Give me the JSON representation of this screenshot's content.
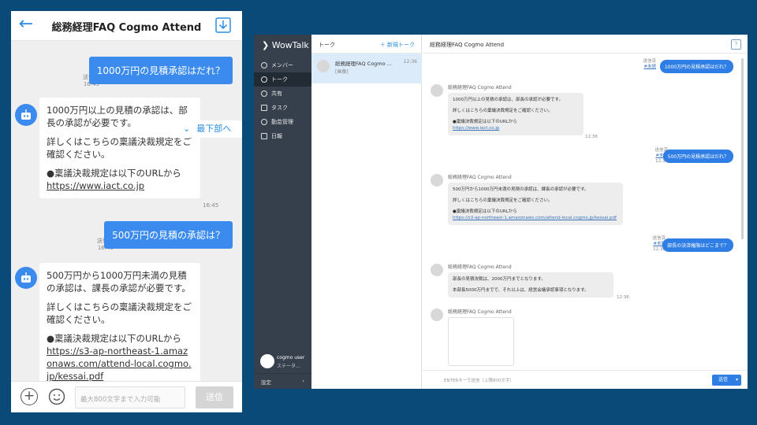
{
  "mobile": {
    "title": "総務経理FAQ Cogmo Attend",
    "messages": [
      {
        "text": "1000万円の見積承認はだれ？",
        "status": "送信済",
        "time": "16:45"
      },
      {
        "text": "500万円の見積の承認は？",
        "status": "送信済",
        "time": "16:45"
      }
    ],
    "reply1": {
      "p1": "1000万円以上の見積の承認は、部長の承認が必要です。",
      "p2": "詳しくはこちらの稟議決裁規定をご確認ください。",
      "p3": "●稟議決裁規定は以下のURLから",
      "url": "https://www.iact.co.jp",
      "time": "16:45"
    },
    "reply2": {
      "p1": "500万円から1000万円未満の見積の承認は、課長の承認が必要です。",
      "p2": "詳しくはこちらの稟議決裁規定をご確認ください。",
      "p3": "●稟議決裁規定は以下のURLから",
      "url": "https://s3-ap-northeast-1.amazonaws.com/attend-local.cogmo.jp/kessai.pdf"
    },
    "scroll_bottom": "最下部へ",
    "input_placeholder": "最大800文字まで入力可能",
    "send": "送信"
  },
  "desktop": {
    "app_name": "WowTalk",
    "sidebar": [
      {
        "label": "メンバー",
        "icon": "person-icon"
      },
      {
        "label": "トーク",
        "icon": "chat-icon"
      },
      {
        "label": "共有",
        "icon": "share-icon"
      },
      {
        "label": "タスク",
        "icon": "task-icon"
      },
      {
        "label": "勤怠管理",
        "icon": "clock-icon"
      },
      {
        "label": "日報",
        "icon": "report-icon"
      }
    ],
    "user_name": "cogmo user",
    "user_status": "ステータ...",
    "settings": "設定",
    "talk_header": "トーク",
    "new_talk": "＋ 新規トーク",
    "talk_item": {
      "name": "総務経理FAQ Cogmo ...",
      "sub": "[画像]",
      "time": "12:36"
    },
    "chat_title": "総務経理FAQ Cogmo Attend",
    "out_status": "送信済",
    "out_read": "#未読",
    "bot_name": "総務経理FAQ Cogmo Attend",
    "out1": "1000万円の見積承認はだれ？",
    "in1_l1": "1000万円以上の見積の承認は、部長の承認が必要です。",
    "in1_l2": "詳しくはこちらの稟議決裁規定をご確認ください。",
    "in1_l3": "●稟議決裁規定は以下のURLから",
    "in1_url": "https://www.iact.co.jp",
    "out2": "500万円の見積承認はだれ？",
    "in2_l1": "500万円から1000万円未満の見積の承認は、課長の承認が必要です。",
    "in2_l2": "詳しくはこちらの稟議決裁規定をご確認ください。",
    "in2_l3": "●稟議決裁規定は以下のURLから",
    "in2_url": "https://s3-ap-northeast-1.amazonaws.com/attend-local.cogmo.jp/kessai.pdf",
    "out3": "部長の決済権限はどこまで？",
    "in3_l1": "部長の見積決裁は、2000万円までとなります。",
    "in3_l2": "本部長5000万円までで、それ以上は、経営会議承認事項となります。",
    "time": "12:36",
    "input_placeholder": "ENTERキーで送信（上限800文字）",
    "send": "送信"
  }
}
